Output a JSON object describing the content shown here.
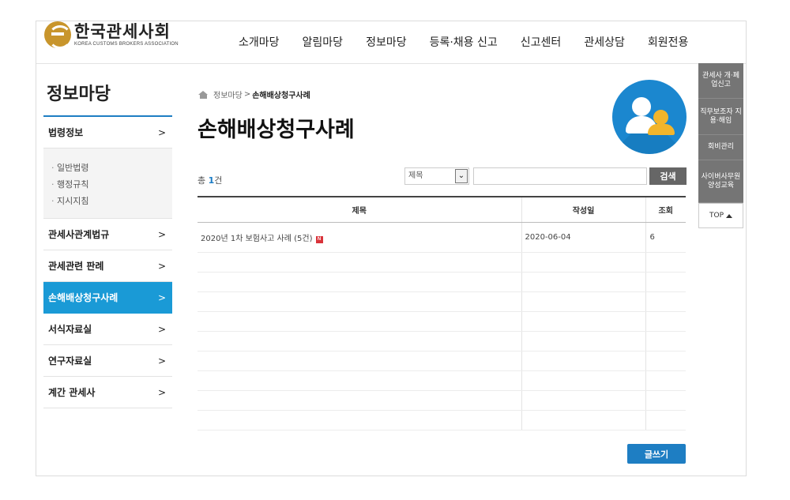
{
  "header": {
    "logo_ko": "한국관세사회",
    "logo_en": "KOREA CUSTOMS BROKERS ASSOCIATION",
    "nav": [
      "소개마당",
      "알림마당",
      "정보마당",
      "등록·채용 신고",
      "신고센터",
      "관세상담",
      "회원전용"
    ]
  },
  "sidebar": {
    "title": "정보마당",
    "items": [
      {
        "label": "법령정보"
      },
      {
        "label": "관세사관계법규"
      },
      {
        "label": "관세관련 판례"
      },
      {
        "label": "손해배상청구사례"
      },
      {
        "label": "서식자료실"
      },
      {
        "label": "연구자료실"
      },
      {
        "label": "계간 관세사"
      }
    ],
    "sub_items": [
      "일반법령",
      "행정규칙",
      "지시지침"
    ]
  },
  "breadcrumb": {
    "parent": "정보마당",
    "sep": ">",
    "current": "손해배상청구사례"
  },
  "page_title": "손해배상청구사례",
  "total": {
    "prefix": "총",
    "count": "1",
    "suffix": "건"
  },
  "search": {
    "select_value": "제목",
    "button_label": "검색"
  },
  "table": {
    "headers": [
      "제목",
      "작성일",
      "조회"
    ],
    "rows": [
      {
        "title": "2020년 1차 보험사고 사례 (5건)",
        "badge": "N",
        "date": "2020-06-04",
        "views": "6"
      }
    ]
  },
  "write_button": "글쓰기",
  "quick_menu": {
    "items": [
      "관세사 개·폐업신고",
      "직무보조자 지용·해임",
      "회비관리",
      "사이버사무원 양성교육"
    ],
    "top_label": "TOP"
  },
  "colors": {
    "accent": "#1e7ec3",
    "active_menu": "#1a9ad6",
    "badge": "#d9333a",
    "quick_menu": "#757575"
  }
}
